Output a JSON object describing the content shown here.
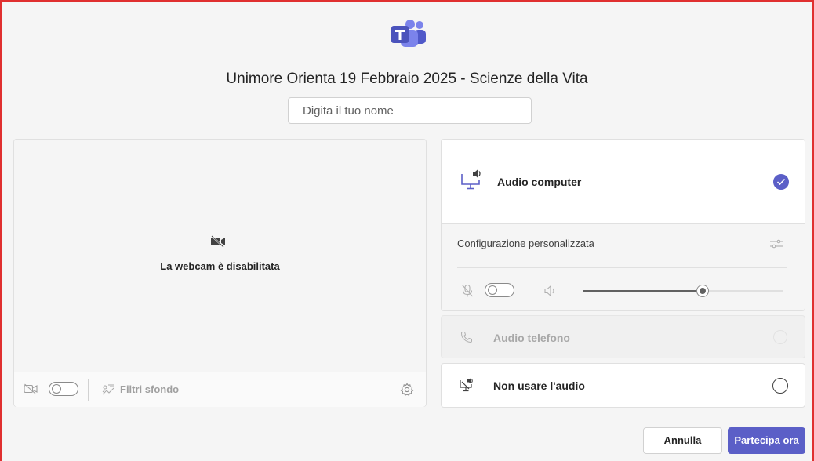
{
  "meeting": {
    "title": "Unimore Orienta 19 Febbraio 2025 - Scienze della Vita",
    "name_placeholder": "Digita il tuo nome",
    "name_value": ""
  },
  "video": {
    "status_text": "La webcam è disabilitata",
    "camera_toggle_on": false,
    "background_filters_label": "Filtri sfondo",
    "icons": [
      "camera-off-icon",
      "background-filter-icon",
      "gear-icon"
    ]
  },
  "audio_options": {
    "computer": {
      "label": "Audio computer",
      "selected": true,
      "icon": "computer-speaker-icon"
    },
    "custom_setup": {
      "label": "Configurazione personalizzata",
      "mic_toggle_on": false,
      "speaker_volume_fraction": 0.6
    },
    "phone": {
      "label": "Audio telefono",
      "disabled": true,
      "icon": "phone-icon"
    },
    "no_audio": {
      "label": "Non usare l'audio",
      "selected": false,
      "icon": "no-audio-icon"
    }
  },
  "actions": {
    "cancel_label": "Annulla",
    "join_label": "Partecipa ora"
  },
  "colors": {
    "accent": "#5b5fc7",
    "frame_border": "#e03030"
  }
}
